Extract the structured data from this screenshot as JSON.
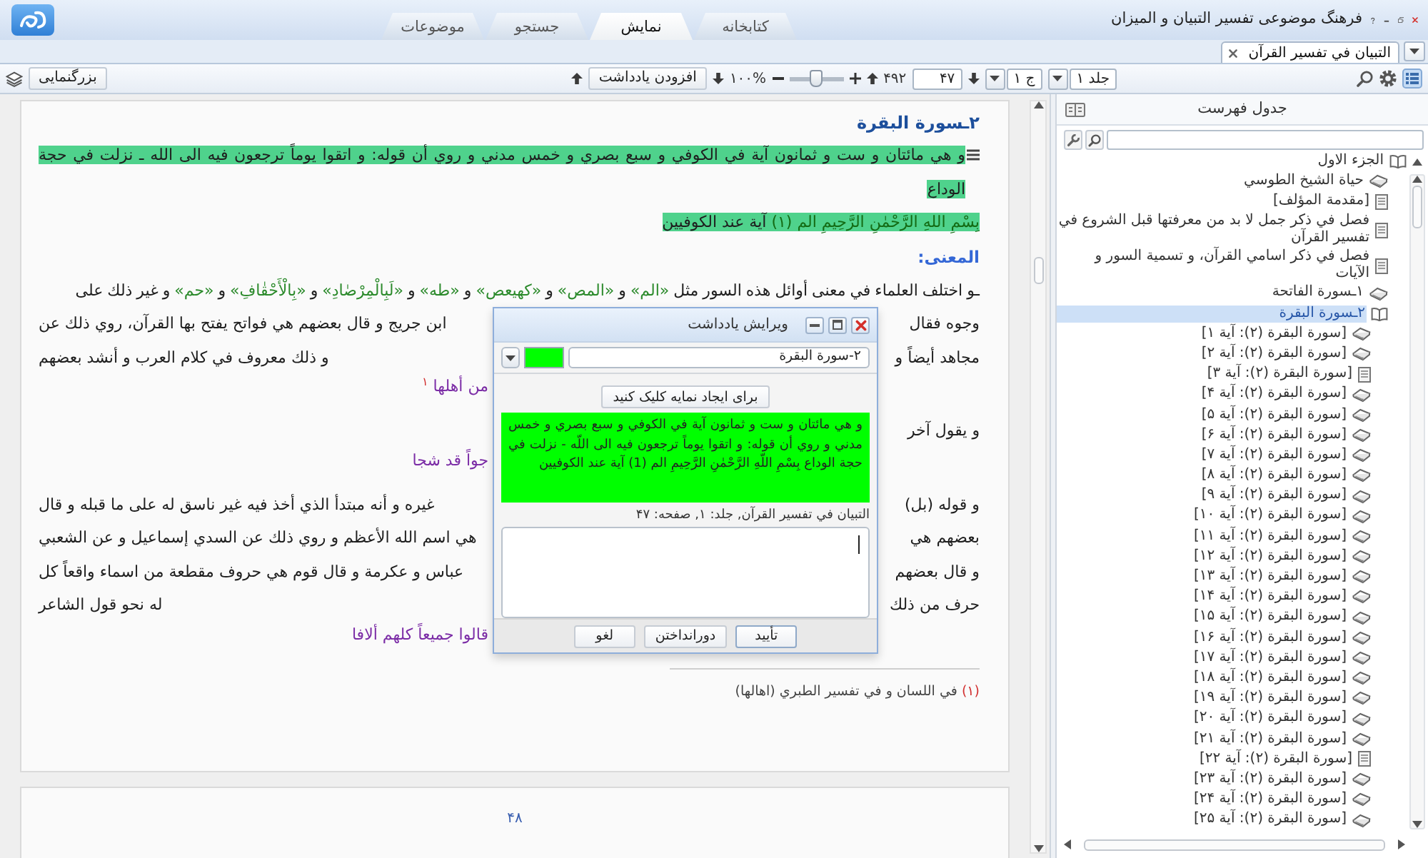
{
  "window": {
    "title": "فرهنگ موضوعی تفسیر التبيان و الميزان"
  },
  "main_tabs": [
    {
      "label": "کتابخانه",
      "selected": false
    },
    {
      "label": "نمایش",
      "selected": true
    },
    {
      "label": "جستجو",
      "selected": false
    },
    {
      "label": "موضوعات",
      "selected": false
    }
  ],
  "document_tabs": [
    {
      "label": "التبيان في تفسير القرآن",
      "selected": true
    }
  ],
  "toolbar": {
    "contents_button": {
      "selected": true
    },
    "volume": "جلد ۱",
    "part": "ج ۱",
    "page": "۴۷",
    "page_count": "۴۹۲",
    "zoom": {
      "level": 0.5,
      "reading": "۱۰۰%"
    },
    "add_note": "افزودن یادداشت",
    "magnify": "بزرگنمایی"
  },
  "sidebar": {
    "title": "جدول فهرست",
    "tree": [
      {
        "label": "الجزء الاول",
        "kind": "book",
        "expanded": true,
        "selected": false,
        "children": [
          {
            "label": "حياة الشيخ الطوسي",
            "kind": "book",
            "selected": false
          },
          {
            "label": "[مقدمة المؤلف]",
            "kind": "page",
            "selected": false
          },
          {
            "label": "فصل في ذكر جمل لا بد من معرفتها قبل الشروع في تفسير القرآن",
            "kind": "page",
            "selected": false
          },
          {
            "label": "فصل في ذكر اسامي القرآن، و تسمية السور و الآيات",
            "kind": "page",
            "selected": false
          },
          {
            "label": "۱ـسورة الفاتحة",
            "kind": "book",
            "selected": false
          },
          {
            "label": "۲ـسورة البقرة",
            "kind": "book",
            "expanded": true,
            "selected": true,
            "children": [
              {
                "label": "[سورة البقرة (۲): آية ۱]",
                "kind": "book",
                "selected": false
              },
              {
                "label": "[سورة البقرة (۲): آية ۲]",
                "kind": "book",
                "selected": false
              },
              {
                "label": "[سورة البقرة (۲): آية ۳]",
                "kind": "page",
                "selected": false
              },
              {
                "label": "[سورة البقرة (۲): آية ۴]",
                "kind": "book",
                "selected": false
              },
              {
                "label": "[سورة البقرة (۲): آية ۵]",
                "kind": "book",
                "selected": false
              },
              {
                "label": "[سورة البقرة (۲): آية ۶]",
                "kind": "book",
                "selected": false
              },
              {
                "label": "[سورة البقرة (۲): آية ۷]",
                "kind": "book",
                "selected": false
              },
              {
                "label": "[سورة البقرة (۲): آية ۸]",
                "kind": "book",
                "selected": false
              },
              {
                "label": "[سورة البقرة (۲): آية ۹]",
                "kind": "book",
                "selected": false
              },
              {
                "label": "[سورة البقرة (۲): آية ۱۰]",
                "kind": "book",
                "selected": false
              },
              {
                "label": "[سورة البقرة (۲): آية ۱۱]",
                "kind": "book",
                "selected": false
              },
              {
                "label": "[سورة البقرة (۲): آية ۱۲]",
                "kind": "book",
                "selected": false
              },
              {
                "label": "[سورة البقرة (۲): آية ۱۳]",
                "kind": "book",
                "selected": false
              },
              {
                "label": "[سورة البقرة (۲): آية ۱۴]",
                "kind": "book",
                "selected": false
              },
              {
                "label": "[سورة البقرة (۲): آية ۱۵]",
                "kind": "book",
                "selected": false
              },
              {
                "label": "[سورة البقرة (۲): آية ۱۶]",
                "kind": "book",
                "selected": false
              },
              {
                "label": "[سورة البقرة (۲): آية ۱۷]",
                "kind": "book",
                "selected": false
              },
              {
                "label": "[سورة البقرة (۲): آية ۱۸]",
                "kind": "book",
                "selected": false
              },
              {
                "label": "[سورة البقرة (۲): آية ۱۹]",
                "kind": "book",
                "selected": false
              },
              {
                "label": "[سورة البقرة (۲): آية ۲۰]",
                "kind": "book",
                "selected": false
              },
              {
                "label": "[سورة البقرة (۲): آية ۲۱]",
                "kind": "book",
                "selected": false
              },
              {
                "label": "[سورة البقرة (۲): آية ۲۲]",
                "kind": "page",
                "selected": false
              },
              {
                "label": "[سورة البقرة (۲): آية ۲۳]",
                "kind": "book",
                "selected": false
              },
              {
                "label": "[سورة البقرة (۲): آية ۲۴]",
                "kind": "book",
                "selected": false
              },
              {
                "label": "[سورة البقرة (۲): آية ۲۵]",
                "kind": "book",
                "selected": false
              }
            ]
          }
        ]
      }
    ]
  },
  "document": {
    "page": {
      "heading": "۲ـسورة البقرة",
      "note": {
        "paragraphs": [
          [
            {
              "kind": "plain",
              "text": "و هي مائتان و ست و ثمانون آية في الكوفي و سبع بصري و خمس مدني و روي أن قوله: و اتقوا يوماً ترجعون فيه الى الله ـ نزلت في حجة الوداع"
            }
          ],
          [
            {
              "kind": "quran",
              "text": "بِسْمِ اللهِ الرَّحْمٰنِ الرَّحِيمِ الم (١)"
            },
            {
              "kind": "plain",
              "text": "آية عند الكوفيين"
            }
          ]
        ]
      },
      "subheading": "المعنى:",
      "lines": [
        {
          "kind": "full",
          "segments": [
            {
              "kind": "plain",
              "text": "ـو اختلف العلماء في معنى أوائل هذه السور مثل"
            },
            {
              "kind": "quran",
              "text": "«الم»"
            },
            {
              "kind": "plain",
              "text": "و"
            },
            {
              "kind": "quran",
              "text": "«المص»"
            },
            {
              "kind": "plain",
              "text": "و"
            },
            {
              "kind": "quran",
              "text": "«كهيعص»"
            },
            {
              "kind": "plain",
              "text": "و"
            },
            {
              "kind": "quran",
              "text": "«طه»"
            },
            {
              "kind": "plain",
              "text": "و"
            },
            {
              "kind": "quran",
              "text": "«لَبِالْمِرْصٰادِ»"
            },
            {
              "kind": "plain",
              "text": "و"
            },
            {
              "kind": "quran",
              "text": "«بِالْأَحْقٰافِ»"
            },
            {
              "kind": "plain",
              "text": "و"
            },
            {
              "kind": "quran",
              "text": "«حم»"
            },
            {
              "kind": "plain",
              "text": "و غير ذلك على"
            }
          ]
        },
        {
          "kind": "split",
          "right": "وجوه فقال",
          "left": "ابن جريج و قال بعضهم هي فواتح يفتح بها القرآن، روي ذلك عن"
        },
        {
          "kind": "split",
          "right": "مجاهد أيضاً و",
          "left": "و ذلك معروف في كلام العرب و أنشد بعضهم"
        },
        {
          "kind": "verse",
          "left": "من أهلها $^{١}$"
        },
        {
          "kind": "split",
          "right": "و يقول آخر"
        },
        {
          "kind": "verse",
          "left": "جواً قد شجا"
        },
        {
          "kind": "split",
          "right": "و قوله (بل)",
          "left": "غيره و أنه مبتدأ الذي أخذ فيه غير ناسق له على ما قبله و قال"
        },
        {
          "kind": "split",
          "right": "بعضهم هي",
          "left": "هي اسم الله الأعظم و روي ذلك عن السدي إسماعيل و عن الشعبي"
        },
        {
          "kind": "split",
          "right": "و قال بعضهم",
          "left": "عباس و عكرمة و قال قوم هي حروف مقطعة من اسماء واقعاً كل"
        },
        {
          "kind": "split",
          "right": "حرف من ذلك",
          "left": "له نحو قول الشاعر"
        },
        {
          "kind": "verse",
          "left": "قالوا جميعاً كلهم ألافا"
        }
      ],
      "footnotes": [
        {
          "mark": "(١)",
          "text": "في اللسان و في تفسير الطبري (اهالها)"
        }
      ]
    },
    "next_page": {
      "number": "۴۸"
    }
  },
  "dialog": {
    "title": "ویرایش یادداشت",
    "topic": "۲-سورة البقرة",
    "color": "#00ff00",
    "index_button": "برای ایجاد نمایه کلیک کنید",
    "quote": "و هي مائتان و ست و ثمانون آية في الكوفي و سبع بصري و خمس مدني و روي أن قوله: و اتقوا يوماً ترجعون فيه الى اللّه - نزلت في حجة الوداع بِسْمِ اللّهِ الرَّحْمٰنِ الرَّحِيمِ الم (1) آية عند الكوفيين",
    "reference": "التبيان في تفسير القرآن, جلد: ۱, صفحه: ۴۷",
    "buttons": [
      {
        "label": "تأیید",
        "kind": "confirm"
      },
      {
        "label": "دورانداختن",
        "kind": "discard"
      },
      {
        "label": "لغو",
        "kind": "cancel"
      }
    ]
  }
}
